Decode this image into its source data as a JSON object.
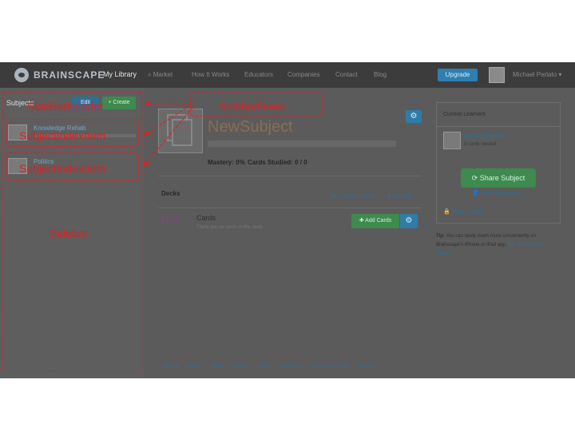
{
  "nav": {
    "brand": "BRAINSCAPE",
    "links": [
      "My Library",
      "Market",
      "How It Works",
      "Educators",
      "Companies",
      "Contact",
      "Blog"
    ],
    "upgrade": "Upgrade",
    "user": "Michael Perlato ▾"
  },
  "sidebar": {
    "title": "Subjects",
    "btn_blue": "Edit",
    "btn_create": "+ Create",
    "items": [
      {
        "name": "Knowledge Rehab"
      },
      {
        "name": "Politics"
      }
    ]
  },
  "subject": {
    "title": "NewSubject",
    "gear": "⚙",
    "mastery": "Mastery: 0%",
    "studied": "Cards Studied: 0 / 0"
  },
  "decks": {
    "heading": "Decks",
    "create": "✚ Create Deck",
    "import": "⬆ Import",
    "rows": [
      {
        "pct": "0%",
        "name": "Cards",
        "empty": "There are no cards in this deck.",
        "add": "✚ Add Cards",
        "gear": "⚙"
      }
    ]
  },
  "learners": {
    "title": "Current Learners",
    "name": "Michael Perlato",
    "sub": "0 cards viewed",
    "share": "⟳ Share Subject",
    "see_all": "👤 See All Learners",
    "private": "🔒 Make Private"
  },
  "tip": {
    "label": "Tip:",
    "text": " You can study much more conveniently on Brainscape's iPhone or iPad app. ",
    "link": "Get Brainscape on iTunes"
  },
  "footer": [
    "Home",
    "About",
    "FAQ",
    "Pricing",
    "Gifts",
    "iOS App",
    "Group Licenses",
    "Terms"
  ],
  "annotations": {
    "sidebar_header": "SideBarHeader",
    "sidebar_rows": "SidebarRows",
    "subject_index_item": "SubjectIndexItem",
    "sidebar": "Sidebar"
  },
  "colors": {
    "annotation": "#e01f1f",
    "overlay": "#5b5b5b",
    "link": "#2f6f93",
    "green": "#3e8a4f"
  }
}
